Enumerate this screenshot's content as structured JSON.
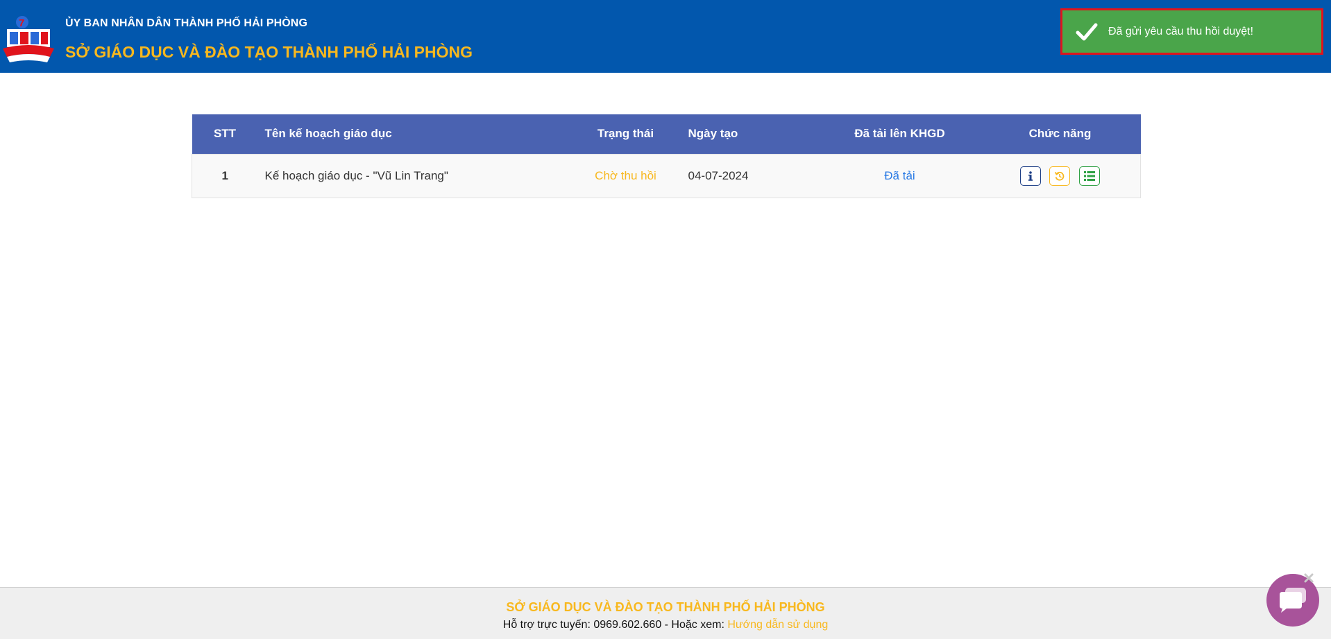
{
  "header": {
    "org_name": "ỦY BAN NHÂN DÂN THÀNH PHỐ HẢI PHÒNG",
    "dept_name": "SỞ GIÁO DỤC VÀ ĐÀO TẠO THÀNH PHỐ HẢI PHÒNG",
    "background_color": "#0257ad",
    "accent_color": "#f8b81e",
    "logo_icon": "education-department-logo"
  },
  "toast": {
    "message": "Đã gửi yêu cầu thu hồi duyệt!",
    "icon": "check-icon",
    "color": "#4aa54a"
  },
  "table": {
    "columns": [
      "STT",
      "Tên kế hoạch giáo dục",
      "Trạng thái",
      "Ngày tạo",
      "Đã tải lên KHGD",
      "Chức năng"
    ],
    "rows": [
      {
        "stt": "1",
        "name": "Kế hoạch giáo dục - \"Vũ Lin Trang\"",
        "status": "Chờ thu hồi",
        "created": "04-07-2024",
        "uploaded": "Đã tải",
        "actions": [
          "info-icon",
          "revoke-icon",
          "list-icon"
        ]
      }
    ]
  },
  "footer": {
    "title": "SỞ GIÁO DỤC VÀ ĐÀO TẠO THÀNH PHỐ HẢI PHÒNG",
    "support_label": "Hỗ trợ trực tuyến: 0969.602.660 - Hoặc xem: ",
    "guide_link": "Hướng dẫn sử dụng"
  },
  "chat": {
    "icon": "chat-bubble-icon",
    "close_icon": "close-icon",
    "color": "#a8539a"
  }
}
